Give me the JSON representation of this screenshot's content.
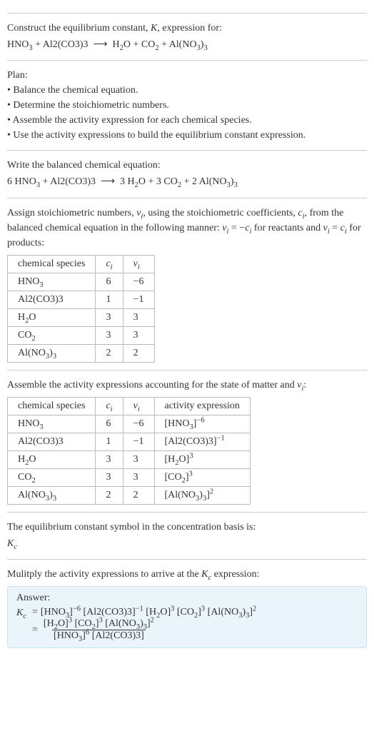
{
  "sec1": {
    "line1_a": "Construct the equilibrium constant, ",
    "line1_K": "K",
    "line1_b": ", expression for:"
  },
  "sec2": {
    "heading": "Plan:",
    "b1": "• Balance the chemical equation.",
    "b2": "• Determine the stoichiometric numbers.",
    "b3": "• Assemble the activity expression for each chemical species.",
    "b4": "• Use the activity expressions to build the equilibrium constant expression."
  },
  "sec3": {
    "heading": "Write the balanced chemical equation:"
  },
  "sec4": {
    "line_a": "Assign stoichiometric numbers, ",
    "nu": "ν",
    "sub_i": "i",
    "line_b": ", using the stoichiometric coefficients, ",
    "c": "c",
    "line_c": ", from the balanced chemical equation in the following manner: ",
    "eq1_lhs_nu": "ν",
    "eq1_eq": " = −",
    "eq1_c": "c",
    "line_d": " for reactants and ",
    "eq2_lhs_nu": "ν",
    "eq2_eq": " = ",
    "eq2_c": "c",
    "line_e": " for products:",
    "table": {
      "h1": "chemical species",
      "h2": "c",
      "h2sub": "i",
      "h3": "ν",
      "h3sub": "i",
      "rows": [
        {
          "species_html": "HNO<sub>3</sub>",
          "ci": "6",
          "nu": "−6"
        },
        {
          "species_html": "Al2(CO3)3",
          "ci": "1",
          "nu": "−1"
        },
        {
          "species_html": "H<sub>2</sub>O",
          "ci": "3",
          "nu": "3"
        },
        {
          "species_html": "CO<sub>2</sub>",
          "ci": "3",
          "nu": "3"
        },
        {
          "species_html": "Al(NO<sub>3</sub>)<sub>3</sub>",
          "ci": "2",
          "nu": "2"
        }
      ]
    }
  },
  "sec5": {
    "line_a": "Assemble the activity expressions accounting for the state of matter and ",
    "nu": "ν",
    "sub_i": "i",
    "line_b": ":",
    "table": {
      "h1": "chemical species",
      "h2": "c",
      "h2sub": "i",
      "h3": "ν",
      "h3sub": "i",
      "h4": "activity expression",
      "rows": [
        {
          "ci": "6",
          "nu": "−6"
        },
        {
          "ci": "1",
          "nu": "−1"
        },
        {
          "ci": "3",
          "nu": "3"
        },
        {
          "ci": "3",
          "nu": "3"
        },
        {
          "ci": "2",
          "nu": "2"
        }
      ]
    }
  },
  "sec6": {
    "line": "The equilibrium constant symbol in the concentration basis is:",
    "Kc_K": "K",
    "Kc_c": "c"
  },
  "sec7": {
    "line_a": "Mulitply the activity expressions to arrive at the ",
    "Kc_K": "K",
    "Kc_c": "c",
    "line_b": " expression:"
  },
  "answer": {
    "label": "Answer:",
    "K": "K",
    "c": "c",
    "eq": " = "
  }
}
